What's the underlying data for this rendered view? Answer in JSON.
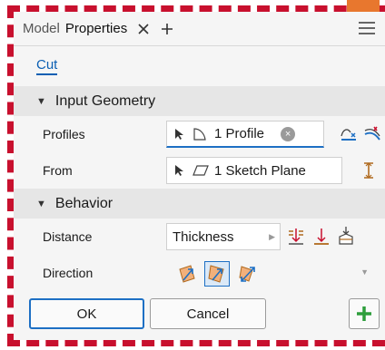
{
  "tabs": [
    {
      "label": "Model"
    },
    {
      "label": "Properties"
    }
  ],
  "feature_name": "Cut",
  "input_geometry": {
    "title": "Input Geometry",
    "profiles_label": "Profiles",
    "profiles_value": "1 Profile",
    "from_label": "From",
    "from_value": "1 Sketch Plane"
  },
  "behavior": {
    "title": "Behavior",
    "distance_label": "Distance",
    "distance_value": "Thickness",
    "direction_label": "Direction"
  },
  "buttons": {
    "ok": "OK",
    "cancel": "Cancel"
  },
  "colors": {
    "accent_blue": "#1d6fc4",
    "frame_red": "#c8102e",
    "add_green": "#2e9e3c",
    "feature_orange": "#e8772e"
  },
  "icons": [
    "close-icon",
    "plus-icon",
    "hamburger-menu-icon",
    "select-arrow-icon",
    "profile-icon",
    "sketch-plane-icon",
    "clear-icon",
    "sketch-profile-icon",
    "flip-icon",
    "offset-icon",
    "distance-icon",
    "direction-default-icon",
    "direction-flipped-icon",
    "direction-symmetric-icon"
  ]
}
